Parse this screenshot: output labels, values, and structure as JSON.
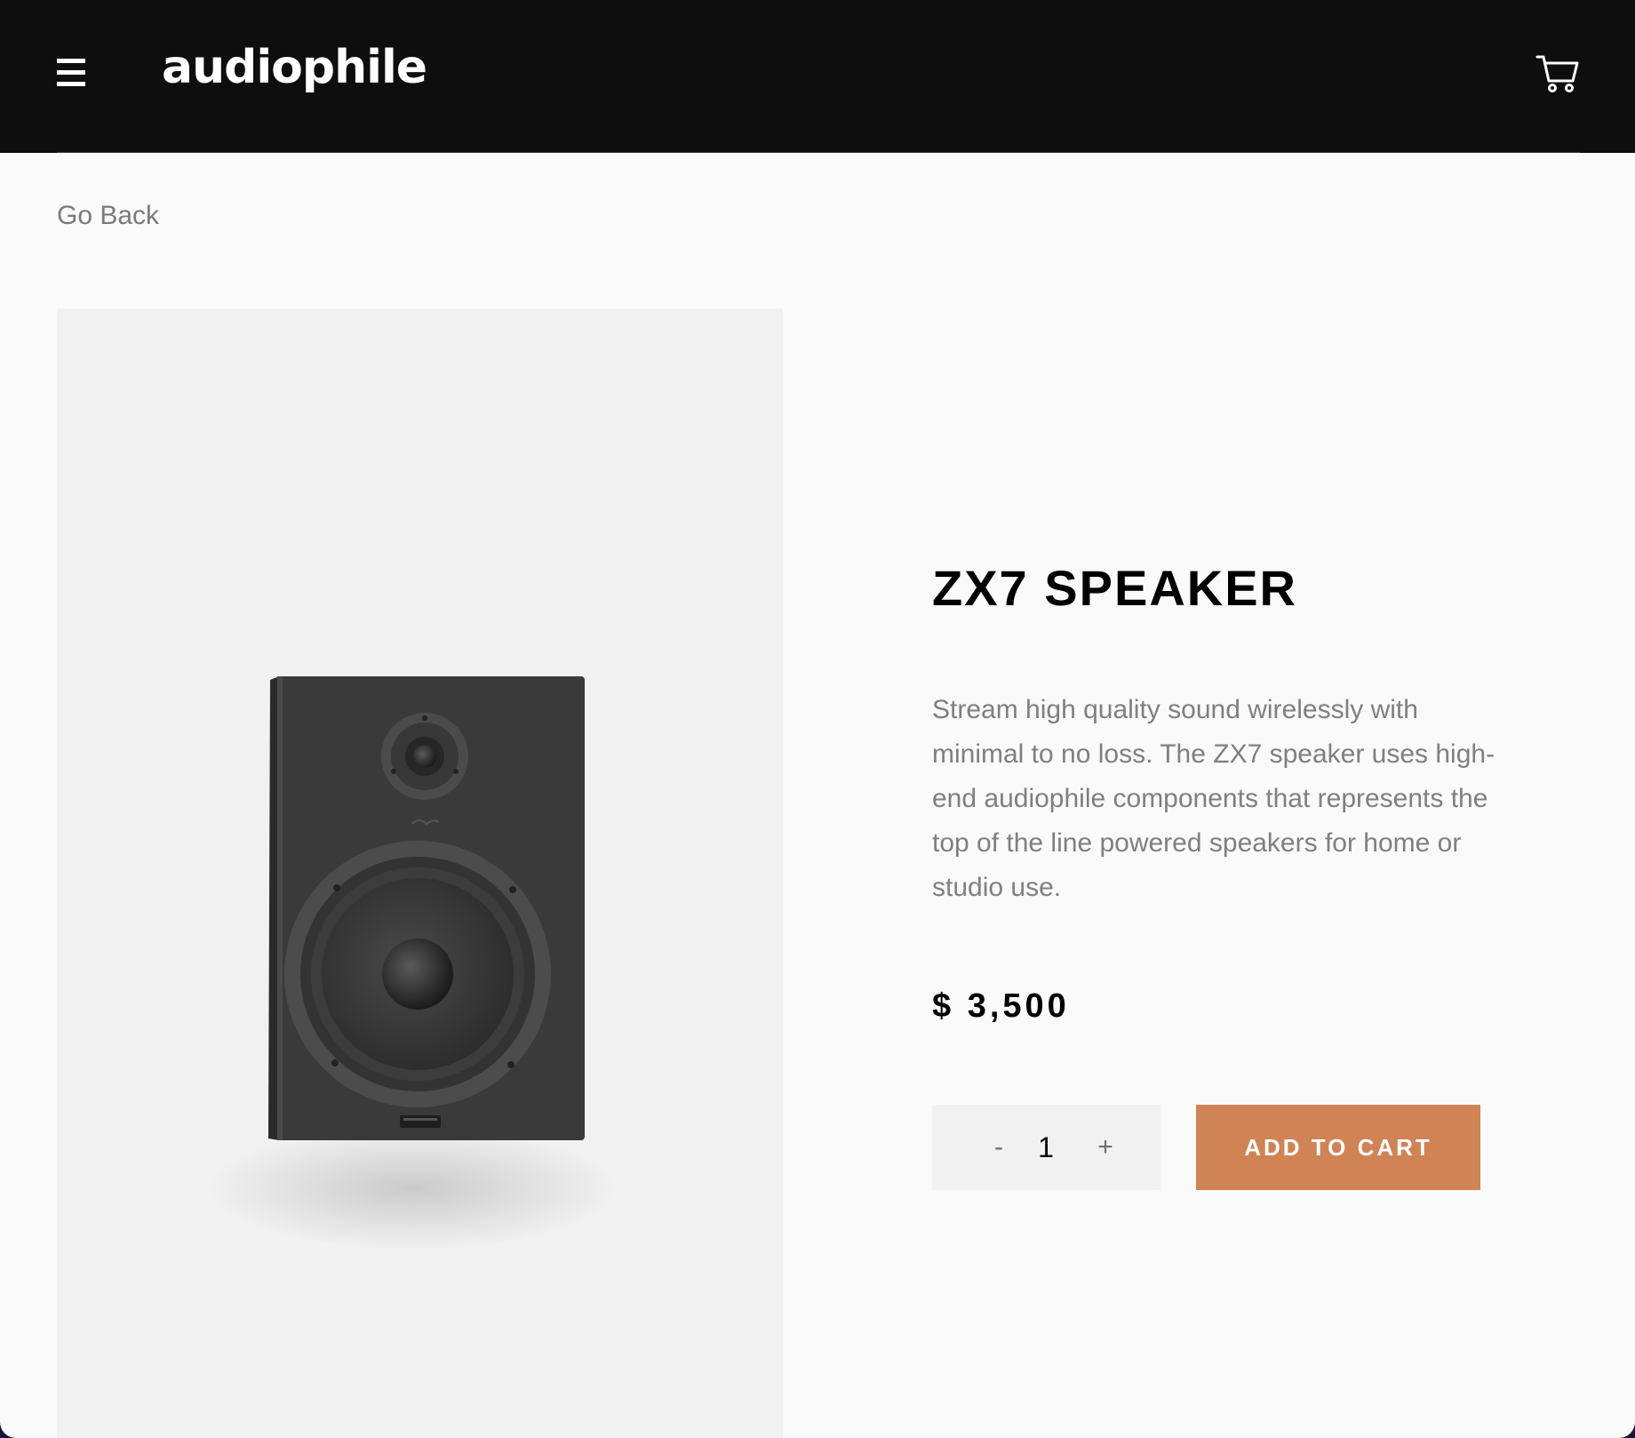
{
  "header": {
    "logo": "audiophile",
    "menu_icon": "hamburger-menu-icon",
    "cart_icon": "shopping-cart-icon"
  },
  "nav": {
    "go_back": "Go Back"
  },
  "product": {
    "title": "ZX7 SPEAKER",
    "description": "Stream high quality sound wirelessly with minimal to no loss. The ZX7 speaker uses high-end audiophile components that represents the top of the line powered speakers for home or studio use.",
    "price": "$ 3,500",
    "image": "speaker-image"
  },
  "quantity": {
    "minus_label": "-",
    "value": "1",
    "plus_label": "+"
  },
  "actions": {
    "add_to_cart": "ADD TO CART"
  },
  "colors": {
    "accent": "#D08355",
    "navbar": "#0E0E0E",
    "background": "#FAFAFA",
    "panel": "#F1F1F1"
  }
}
